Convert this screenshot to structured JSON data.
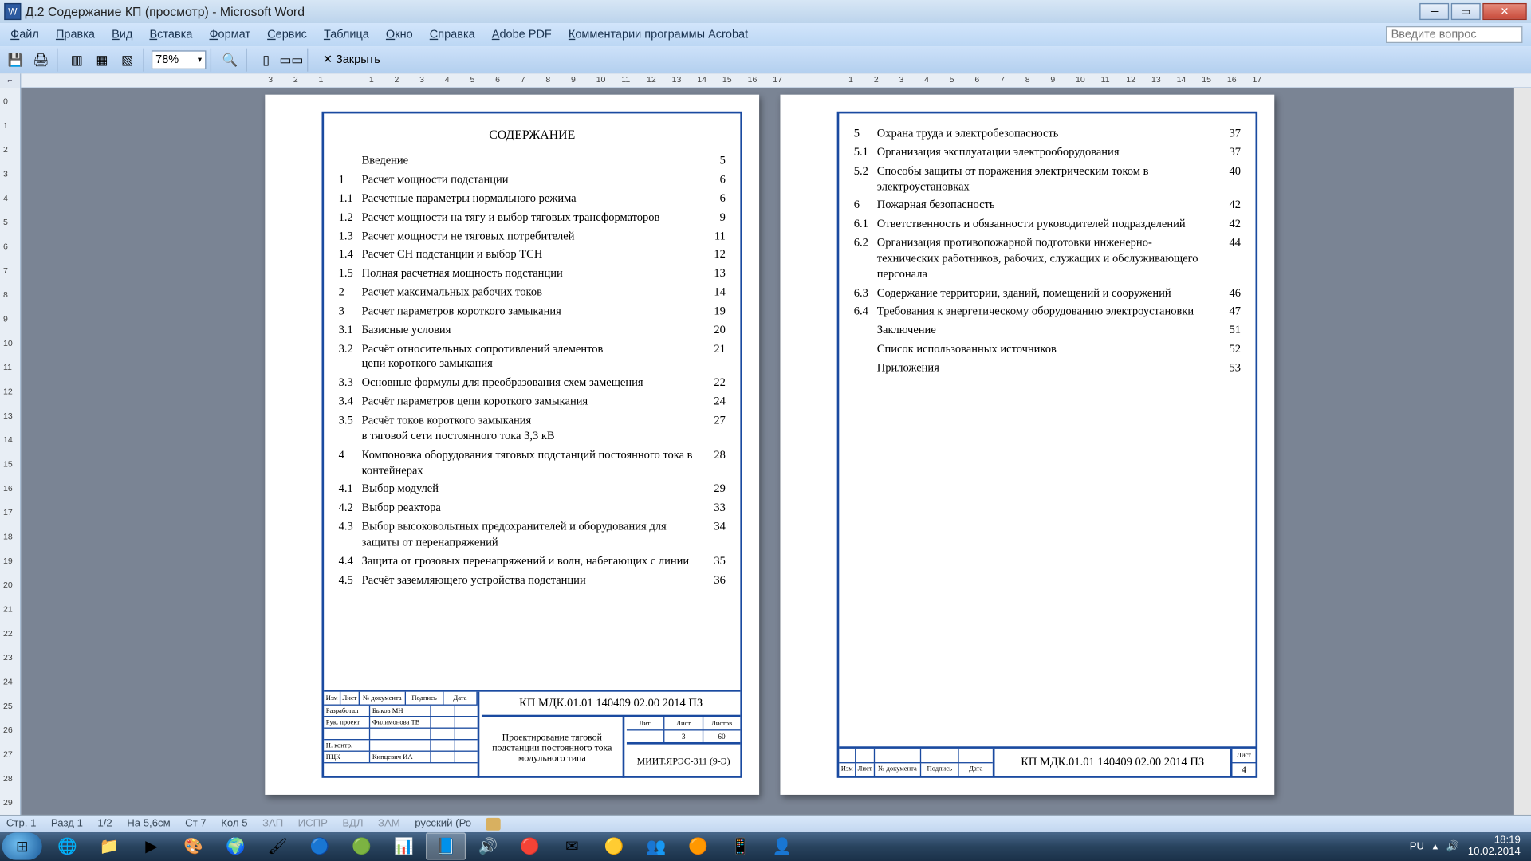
{
  "window": {
    "title": "Д.2 Содержание КП (просмотр) - Microsoft Word"
  },
  "menu": {
    "items": [
      "Файл",
      "Правка",
      "Вид",
      "Вставка",
      "Формат",
      "Сервис",
      "Таблица",
      "Окно",
      "Справка",
      "Adobe PDF",
      "Комментарии программы Acrobat"
    ],
    "ask_placeholder": "Введите вопрос"
  },
  "toolbar": {
    "zoom": "78%",
    "close_label": "Закрыть"
  },
  "ruler": {
    "corner": "⌐"
  },
  "doc": {
    "title": "СОДЕРЖАНИЕ",
    "toc1": [
      {
        "n": "",
        "t": "Введение",
        "p": "5"
      },
      {
        "n": "1",
        "t": "Расчет мощности подстанции",
        "p": "6"
      },
      {
        "n": "1.1",
        "t": "Расчетные параметры нормального режима",
        "p": "6"
      },
      {
        "n": "1.2",
        "t": "Расчет  мощности  на тягу и выбор тяговых трансформаторов",
        "p": "9"
      },
      {
        "n": "1.3",
        "t": "Расчет мощности не тяговых потребителей",
        "p": "11"
      },
      {
        "n": "1.4",
        "t": "Расчет CH подстанции и выбор  TCH",
        "p": "12"
      },
      {
        "n": "1.5",
        "t": "Полная расчетная мощность подстанции",
        "p": "13"
      },
      {
        "n": "2",
        "t": "Расчет максимальных рабочих токов",
        "p": "14"
      },
      {
        "n": "3",
        "t": "Расчет параметров короткого замыкания",
        "p": "19"
      },
      {
        "n": "3.1",
        "t": "Базисные условия",
        "p": "20"
      },
      {
        "n": "3.2",
        "t": "Расчёт относительных сопротивлений элементов",
        "p": "21",
        "cont": "цепи короткого замыкания"
      },
      {
        "n": "3.3",
        "t": "Основные формулы для преобразования схем замещения",
        "p": "22"
      },
      {
        "n": "3.4",
        "t": "Расчёт параметров цепи короткого замыкания",
        "p": "24"
      },
      {
        "n": "3.5",
        "t": "Расчёт токов короткого замыкания",
        "p": "27",
        "cont": "в тяговой сети постоянного тока 3,3  кВ"
      },
      {
        "n": "4",
        "t": "Компоновка оборудования тяговых подстанций постоянного тока в контейнерах",
        "p": "28"
      },
      {
        "n": "4.1",
        "t": "Выбор модулей",
        "p": "29"
      },
      {
        "n": "4.2",
        "t": "Выбор реактора",
        "p": "33"
      },
      {
        "n": "4.3",
        "t": "Выбор высоковольтных предохранителей и оборудования для защиты от перенапряжений",
        "p": "34"
      },
      {
        "n": "4.4",
        "t": "Защита от грозовых перенапряжений и волн, набегающих с линии",
        "p": "35"
      },
      {
        "n": "4.5",
        "t": "Расчёт заземляющего устройства подстанции",
        "p": "36"
      }
    ],
    "toc2": [
      {
        "n": "5",
        "t": "Охрана труда и электробезопасность",
        "p": "37"
      },
      {
        "n": "5.1",
        "t": "Организация эксплуатации электрооборудования",
        "p": "37"
      },
      {
        "n": "5.2",
        "t": "Способы защиты от поражения электрическим током в электроустановках",
        "p": "40"
      },
      {
        "n": "6",
        "t": "Пожарная безопасность",
        "p": "42"
      },
      {
        "n": "6.1",
        "t": "Ответственность и обязанности руководителей подразделений",
        "p": "42"
      },
      {
        "n": "6.2",
        "t": "Организация противопожарной подготовки инженерно-технических работников, рабочих, служащих и обслуживающего персонала",
        "p": "44"
      },
      {
        "n": "6.3",
        "t": "Содержание территории, зданий, помещений и сооружений",
        "p": "46"
      },
      {
        "n": "6.4",
        "t": "Требования к энергетическому оборудованию электроустановки",
        "p": "47"
      },
      {
        "n": "",
        "t": "Заключение",
        "p": "51"
      },
      {
        "n": "",
        "t": "Список использованных источников",
        "p": "52"
      },
      {
        "n": "",
        "t": "Приложения",
        "p": "53"
      }
    ],
    "stamp": {
      "hdrs": {
        "izm": "Изм",
        "list": "Лист",
        "doc": "№ документа",
        "sign": "Подпись",
        "date": "Дата"
      },
      "rows": [
        {
          "lab": "Разработал",
          "val": "Быков МН"
        },
        {
          "lab": "Рук. проект",
          "val": "Филимонова ТВ"
        },
        {
          "lab": "",
          "val": ""
        },
        {
          "lab": "Н. контр.",
          "val": ""
        },
        {
          "lab": "ПЦК",
          "val": "Кипцевич ИА"
        }
      ],
      "code": "КП МДК.01.01 140409 02.00 2014 ПЗ",
      "project": "Проектирование тяговой подстанции постоянного тока модульного типа",
      "rt_hdrs": {
        "lit": "Лит.",
        "list": "Лист",
        "lists": "Листов"
      },
      "rt_vals": {
        "lit": "",
        "list": "3",
        "lists": "60"
      },
      "group": "МИИТ.ЯРЭС-311 (9-Э)",
      "page2_list_label": "Лист",
      "page2_num": "4"
    }
  },
  "hscroll": {
    "page_indicator": "1/2"
  },
  "status": {
    "page": "Стр. 1",
    "section": "Разд 1",
    "pages": "1/2",
    "pos": "На  5,6см",
    "line": "Ст  7",
    "col": "Кол  5",
    "rec": "ЗАП",
    "trk": "ИСПР",
    "ext": "ВДЛ",
    "ovr": "ЗАМ",
    "lang": "русский (Ро"
  },
  "taskbar": {
    "icons": [
      "🌐",
      "📁",
      "▶",
      "🎨",
      "🌍",
      "🖌",
      "🔵",
      "🟢",
      "📊",
      "📘",
      "🔊",
      "🔴",
      "✉",
      "🟡",
      "👥",
      "🟠",
      "📱",
      "👤"
    ],
    "active_idx": 9,
    "lang": "РU",
    "time": "18:19",
    "date": "10.02.2014"
  }
}
